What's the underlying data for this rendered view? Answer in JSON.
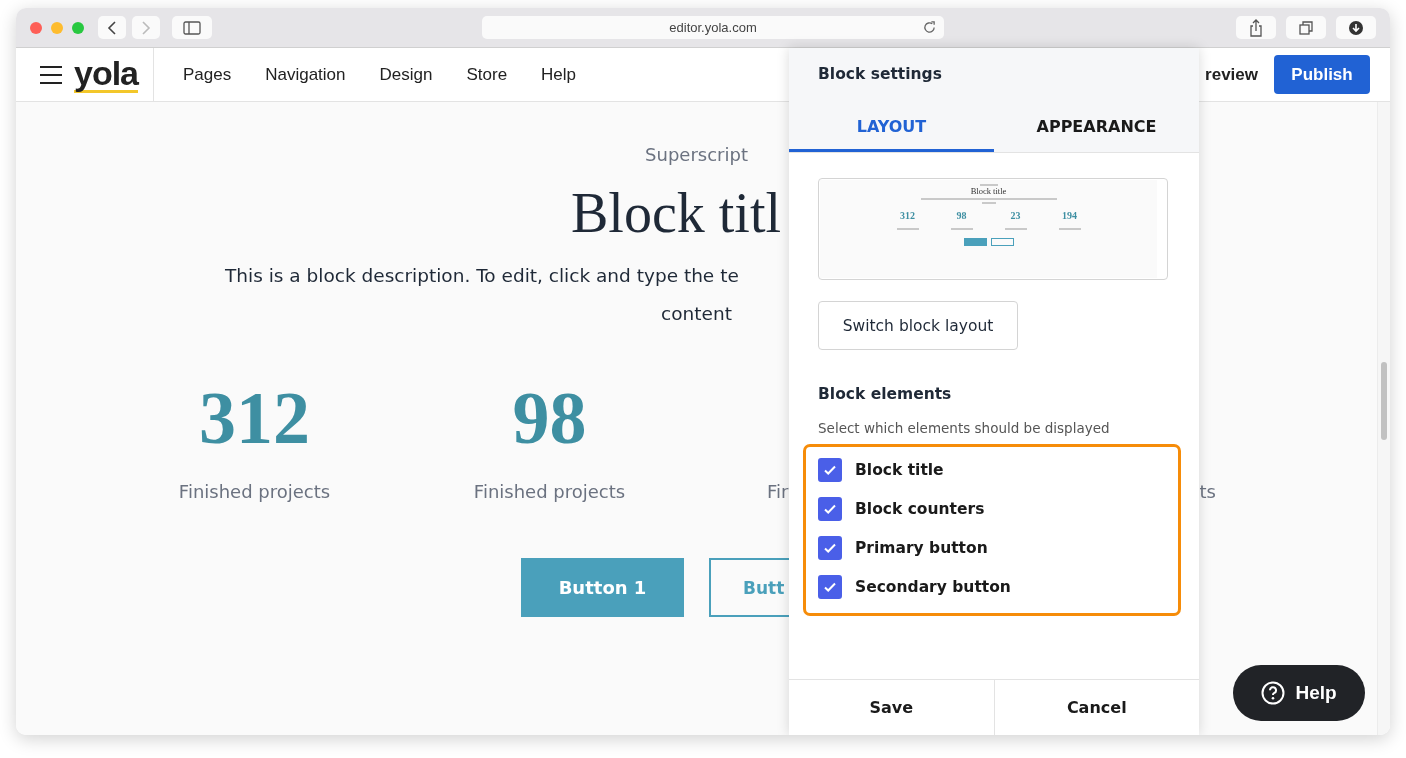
{
  "browser": {
    "url": "editor.yola.com"
  },
  "header": {
    "logo": "yola",
    "nav": [
      "Pages",
      "Navigation",
      "Design",
      "Store",
      "Help"
    ],
    "preview": "review",
    "publish": "Publish"
  },
  "block": {
    "superscript": "Superscript",
    "title": "Block titl",
    "description": "This is a block description. To edit, click and type the te",
    "description_end": "content",
    "counters": [
      {
        "number": "312",
        "label": "Finished projects"
      },
      {
        "number": "98",
        "label": "Finished projects"
      },
      {
        "label": "Fir"
      },
      {
        "label": "ts"
      }
    ],
    "buttons": [
      {
        "label": "Button 1",
        "kind": "primary"
      },
      {
        "label": "Butt",
        "kind": "secondary"
      }
    ]
  },
  "panel": {
    "title": "Block settings",
    "tabs": [
      {
        "label": "LAYOUT",
        "selected": true
      },
      {
        "label": "APPEARANCE",
        "selected": false
      }
    ],
    "thumbnail": {
      "title": "Block title",
      "counters": [
        "312",
        "98",
        "23",
        "194"
      ]
    },
    "switch_button": "Switch block layout",
    "section_title": "Block elements",
    "section_hint": "Select which elements should be displayed",
    "elements": [
      {
        "label": "Block title",
        "checked": true
      },
      {
        "label": "Block counters",
        "checked": true
      },
      {
        "label": "Primary button",
        "checked": true
      },
      {
        "label": "Secondary button",
        "checked": true
      }
    ],
    "footer": [
      "Save",
      "Cancel"
    ]
  },
  "help_button": "Help"
}
